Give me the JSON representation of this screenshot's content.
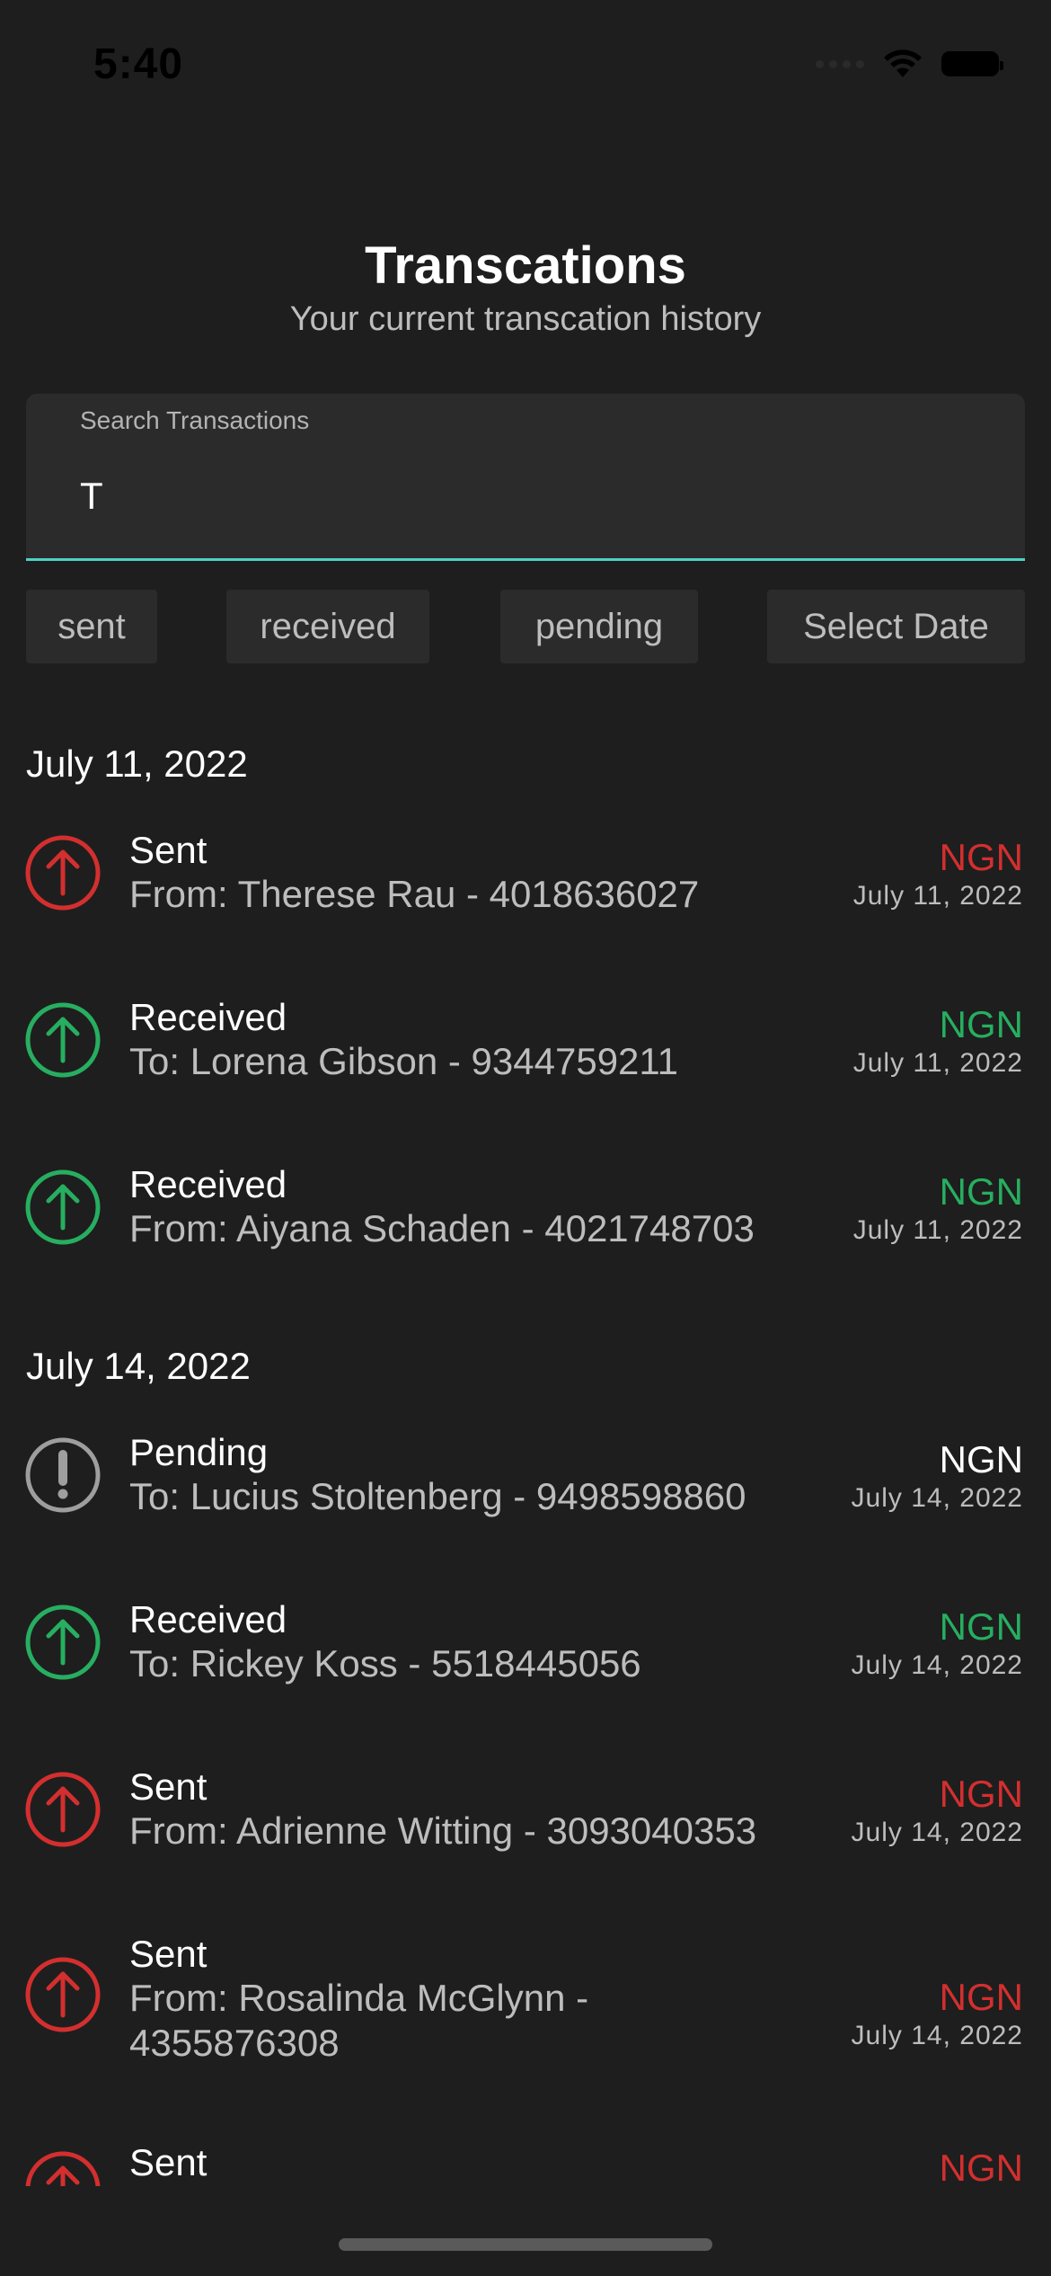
{
  "status_bar": {
    "time": "5:40"
  },
  "header": {
    "title": "Transcations",
    "subtitle": "Your current transcation history"
  },
  "search": {
    "label": "Search Transactions",
    "value": "T"
  },
  "filters": [
    {
      "label": "sent"
    },
    {
      "label": "received"
    },
    {
      "label": "pending"
    },
    {
      "label": "Select Date"
    }
  ],
  "colors": {
    "sent": "#d32f2f",
    "received": "#27ae60",
    "pending": "#9e9e9e",
    "accent": "#4fd1c5",
    "background": "#1e1e1e"
  },
  "sections": [
    {
      "date": "July 11, 2022",
      "transactions": [
        {
          "type": "sent",
          "icon": "arrow-up-circle-icon",
          "title": "Sent",
          "desc": "From: Therese Rau - 4018636027",
          "amount": "NGN",
          "date": "July 11, 2022"
        },
        {
          "type": "received",
          "icon": "arrow-up-circle-icon",
          "title": "Received",
          "desc": "To: Lorena Gibson - 9344759211",
          "amount": "NGN",
          "date": "July 11, 2022"
        },
        {
          "type": "received",
          "icon": "arrow-up-circle-icon",
          "title": "Received",
          "desc": "From: Aiyana Schaden - 4021748703",
          "amount": "NGN",
          "date": "July 11, 2022"
        }
      ]
    },
    {
      "date": "July 14, 2022",
      "transactions": [
        {
          "type": "pending",
          "icon": "exclamation-circle-icon",
          "title": "Pending",
          "desc": "To: Lucius Stoltenberg - 9498598860",
          "amount": "NGN",
          "date": "July 14, 2022"
        },
        {
          "type": "received",
          "icon": "arrow-up-circle-icon",
          "title": "Received",
          "desc": "To: Rickey Koss - 5518445056",
          "amount": "NGN",
          "date": "July 14, 2022"
        },
        {
          "type": "sent",
          "icon": "arrow-up-circle-icon",
          "title": "Sent",
          "desc": "From: Adrienne Witting - 3093040353",
          "amount": "NGN",
          "date": "July 14, 2022"
        },
        {
          "type": "sent",
          "icon": "arrow-up-circle-icon",
          "title": "Sent",
          "desc": "From: Rosalinda McGlynn - 4355876308",
          "amount": "NGN",
          "date": "July 14, 2022"
        },
        {
          "type": "sent",
          "icon": "arrow-up-circle-icon",
          "title": "Sent",
          "desc": "",
          "amount": "NGN",
          "date": ""
        }
      ]
    }
  ]
}
